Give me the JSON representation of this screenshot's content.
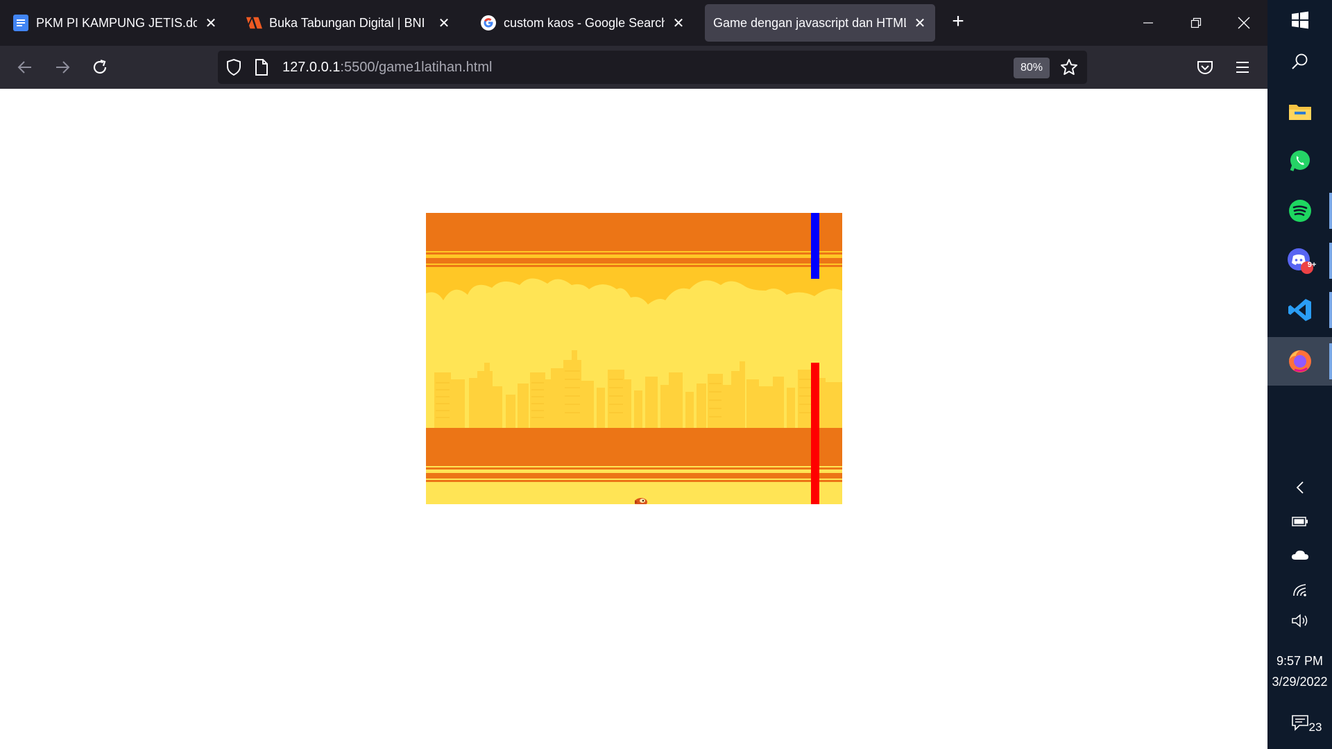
{
  "browser": {
    "tabs": [
      {
        "label": "PKM PI KAMPUNG JETIS.docx - ",
        "favicon": "docs-icon",
        "active": false
      },
      {
        "label": "Buka Tabungan Digital | BNI",
        "favicon": "bni-icon",
        "active": false
      },
      {
        "label": "custom kaos - Google Search",
        "favicon": "google-icon",
        "active": false
      },
      {
        "label": "Game dengan javascript dan HTML",
        "favicon": "none",
        "active": true
      }
    ],
    "close_glyph": "✕",
    "new_tab_glyph": "+",
    "url_host": "127.0.0.1",
    "url_path": ":5500/game1latihan.html",
    "zoom": "80%"
  },
  "game": {
    "pipes": [
      {
        "color": "#0000ff",
        "position": "top"
      },
      {
        "color": "#ff0000",
        "position": "bottom"
      }
    ],
    "colors": {
      "sky": "#ffc726",
      "band": "#ec7516",
      "cloud": "#ffe455",
      "city": "#ffd23c"
    }
  },
  "taskbar": {
    "apps": [
      "windows-start-icon",
      "search-icon",
      "file-explorer-icon",
      "whatsapp-icon",
      "spotify-icon",
      "discord-icon",
      "vscode-icon",
      "firefox-icon"
    ],
    "discord_badge": "9+",
    "time": "9:57 PM",
    "date": "3/29/2022",
    "notification_count": "23"
  }
}
